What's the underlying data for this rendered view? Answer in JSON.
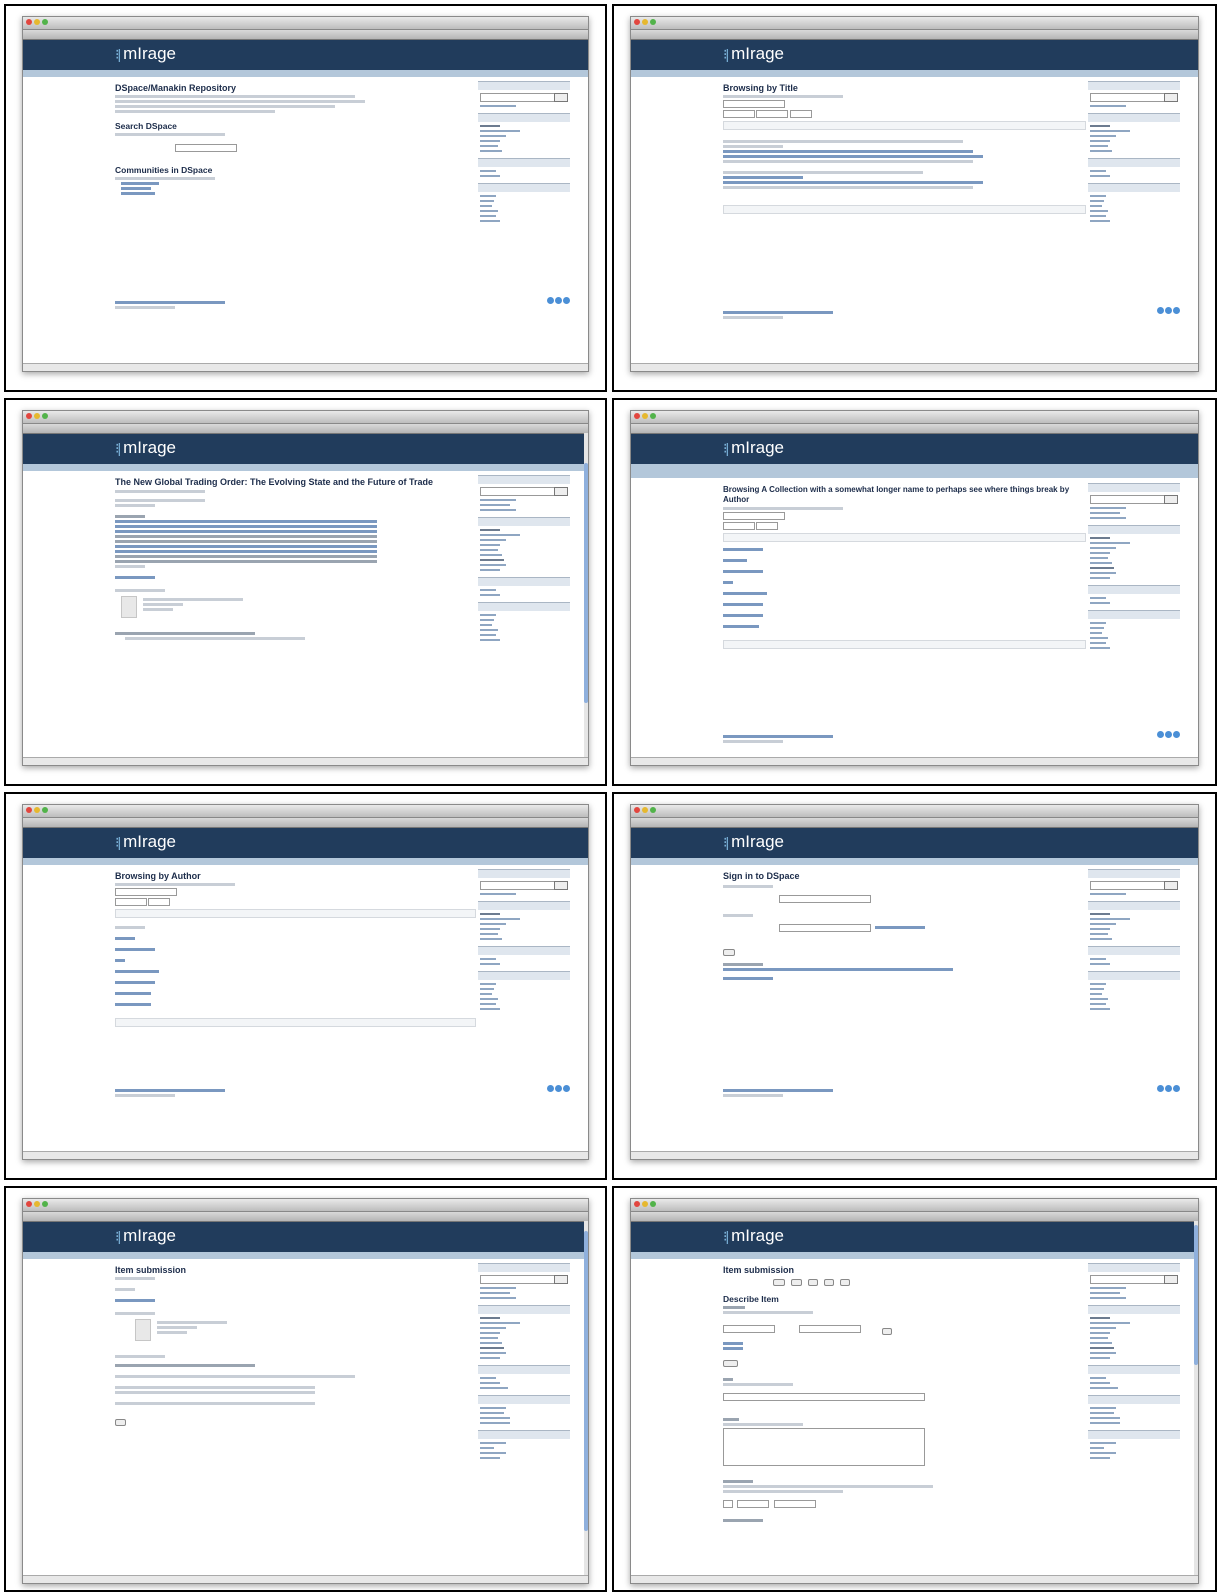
{
  "banner": {
    "logo_text": "mIrage",
    "logo_icon": "dots-bars-icon",
    "colors": {
      "banner": "#213c5c",
      "crumbs": "#b3c7da",
      "link": "#2f5f9e",
      "heading": "#1c2c4a"
    }
  },
  "panels": [
    {
      "page_title": "DSpace/Manakin Repository",
      "sections": [
        "Search DSpace",
        "Communities in DSpace"
      ]
    },
    {
      "page_title": "Browsing by Title"
    },
    {
      "page_title": "The New Global Trading Order: The Evolving State and the Future of Trade"
    },
    {
      "page_title": "Browsing A Collection with a somewhat longer name to perhaps see where things break by Author"
    },
    {
      "page_title": "Browsing by Author"
    },
    {
      "page_title": "Sign in to DSpace"
    },
    {
      "page_title": "Item submission"
    },
    {
      "page_title": "Item submission",
      "sections": [
        "Describe Item"
      ]
    }
  ]
}
